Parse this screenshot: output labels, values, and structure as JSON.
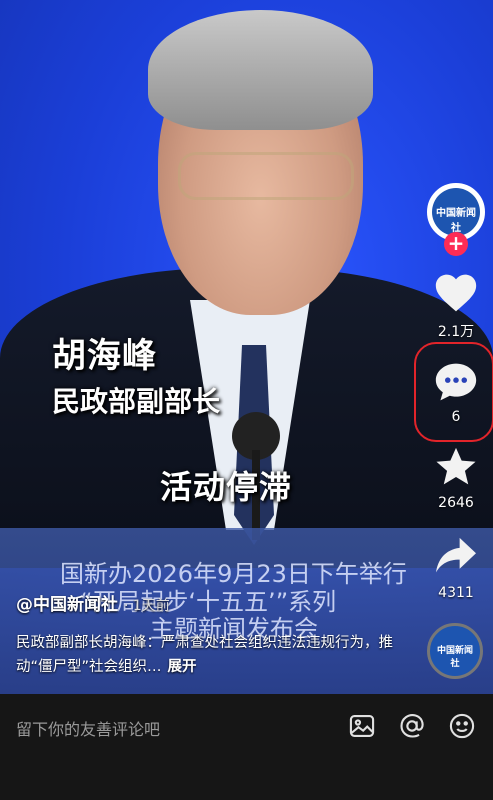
{
  "video": {
    "overlay_name": "胡海峰",
    "overlay_title": "民政部副部长",
    "overlay_caption": "活动停滞",
    "banner_lines": [
      "国新办2026年9月23日下午举行",
      "“开局起步‘十五五’”系列",
      "主题新闻发布会"
    ]
  },
  "post": {
    "author": "@中国新闻社",
    "time": "· 1天前",
    "description": "民政部副部长胡海峰：严肃查处社会组织违法违规行为，推动“僵尸型”社会组织…",
    "expand_label": "展开"
  },
  "sidebar": {
    "avatar_text": "中国新闻社",
    "follow_label": "+",
    "likes": "2.1万",
    "comments": "6",
    "favorites": "2646",
    "shares": "4311"
  },
  "bottom_bar": {
    "comment_placeholder": "留下你的友善评论吧"
  },
  "colors": {
    "accent_red": "#fd2c55",
    "highlight_ring": "#e2242a",
    "video_blue": "#1b3fd8"
  }
}
